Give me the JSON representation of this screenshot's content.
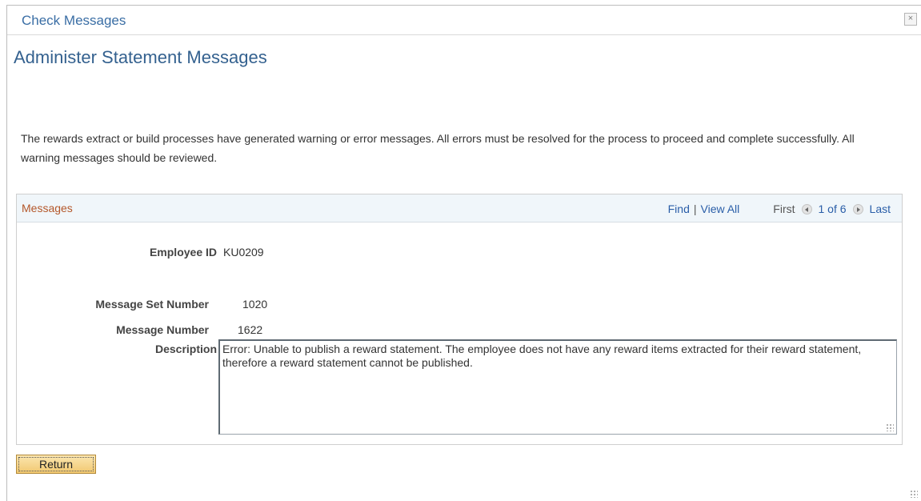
{
  "dialog": {
    "title": "Check Messages",
    "close_glyph": "×"
  },
  "page": {
    "title": "Administer Statement Messages",
    "intro": "The rewards extract or build processes have generated warning or error messages.  All errors must be resolved for the process to proceed and complete successfully.  All warning messages should be reviewed."
  },
  "messages_panel": {
    "title": "Messages",
    "find_label": "Find",
    "separator": "|",
    "view_all_label": "View All",
    "first_label": "First",
    "count_label": "1 of 6",
    "last_label": "Last",
    "fields": {
      "employee_id_label": "Employee ID",
      "employee_id_value": "KU0209",
      "message_set_label": "Message Set Number",
      "message_set_value": "1020",
      "message_number_label": "Message Number",
      "message_number_value": "1622",
      "description_label": "Description",
      "description_value": "Error:  Unable to publish a reward statement.  The employee does not have any reward items extracted for their reward statement, therefore a reward statement cannot be published."
    }
  },
  "actions": {
    "return_label": "Return"
  },
  "icons": {
    "close": "close-icon",
    "prev": "previous-arrow-icon",
    "next": "next-arrow-icon",
    "resize": "resize-grip-icon"
  }
}
